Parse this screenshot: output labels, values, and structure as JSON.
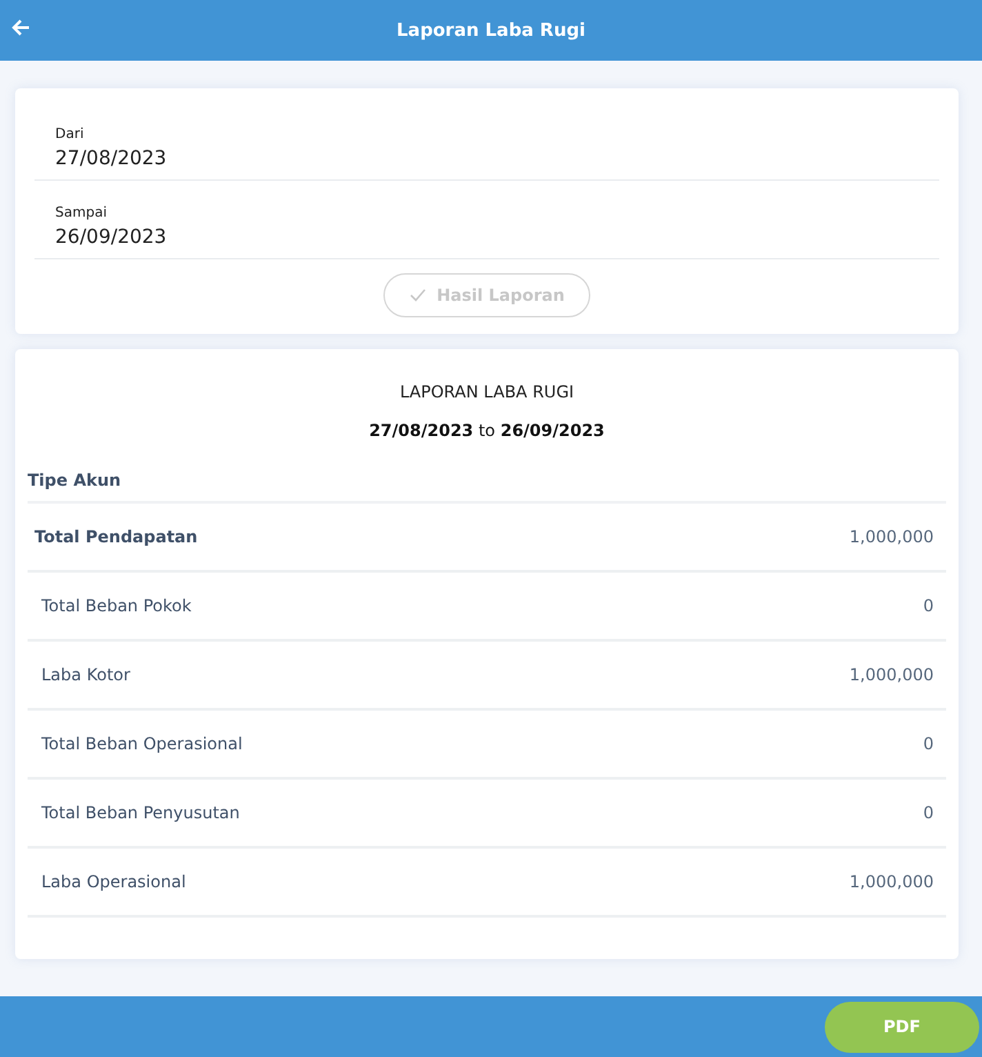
{
  "header": {
    "title": "Laporan Laba Rugi"
  },
  "filter": {
    "fields": [
      {
        "label": "Dari",
        "value": "27/08/2023"
      },
      {
        "label": "Sampai",
        "value": "26/09/2023"
      }
    ],
    "submit": {
      "label": "Hasil Laporan",
      "disabled": true
    }
  },
  "report": {
    "title": "LAPORAN LABA RUGI",
    "start": "27/08/2023",
    "connector": "to",
    "end": "26/09/2023",
    "column_header": "Tipe Akun",
    "rows": [
      {
        "name": "Total Pendapatan",
        "amount": "1,000,000",
        "bold": true
      },
      {
        "name": "Total Beban Pokok",
        "amount": "0",
        "bold": false
      },
      {
        "name": "Laba Kotor",
        "amount": "1,000,000",
        "bold": false
      },
      {
        "name": "Total Beban Operasional",
        "amount": "0",
        "bold": false
      },
      {
        "name": "Total Beban Penyusutan",
        "amount": "0",
        "bold": false
      },
      {
        "name": "Laba Operasional",
        "amount": "1,000,000",
        "bold": false
      }
    ]
  },
  "footer": {
    "pdf_button": "PDF"
  }
}
